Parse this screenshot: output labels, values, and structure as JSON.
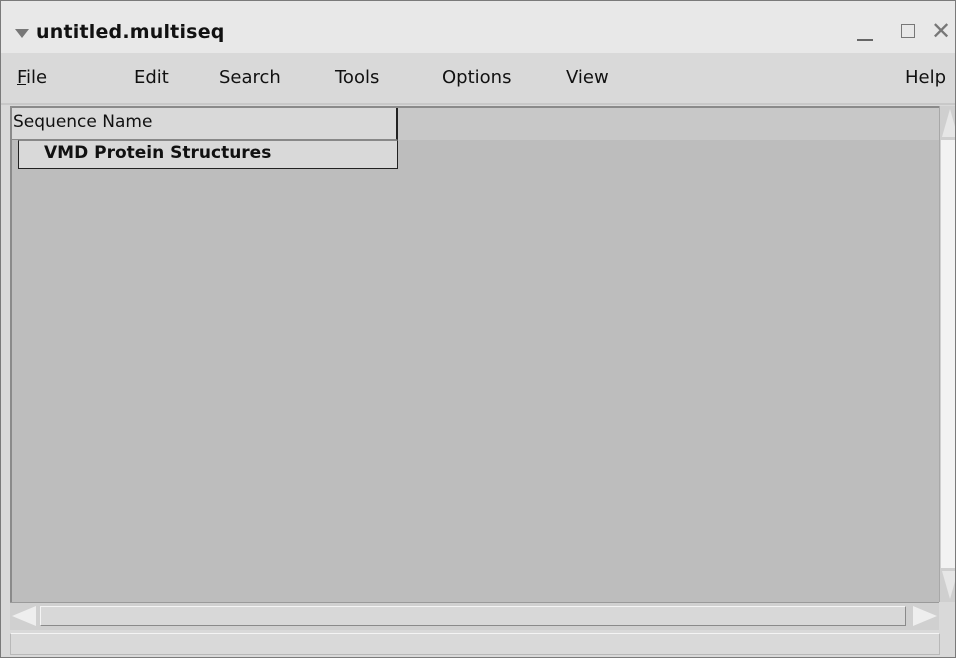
{
  "window": {
    "title": "untitled.multiseq"
  },
  "menu": {
    "file": "File",
    "edit": "Edit",
    "search": "Search",
    "tools": "Tools",
    "options": "Options",
    "view": "View",
    "help": "Help"
  },
  "table": {
    "header": "Sequence Name",
    "rows": [
      "VMD Protein Structures"
    ]
  },
  "colors": {
    "background": "#bdbdbd",
    "chrome": "#d9d9d9"
  }
}
